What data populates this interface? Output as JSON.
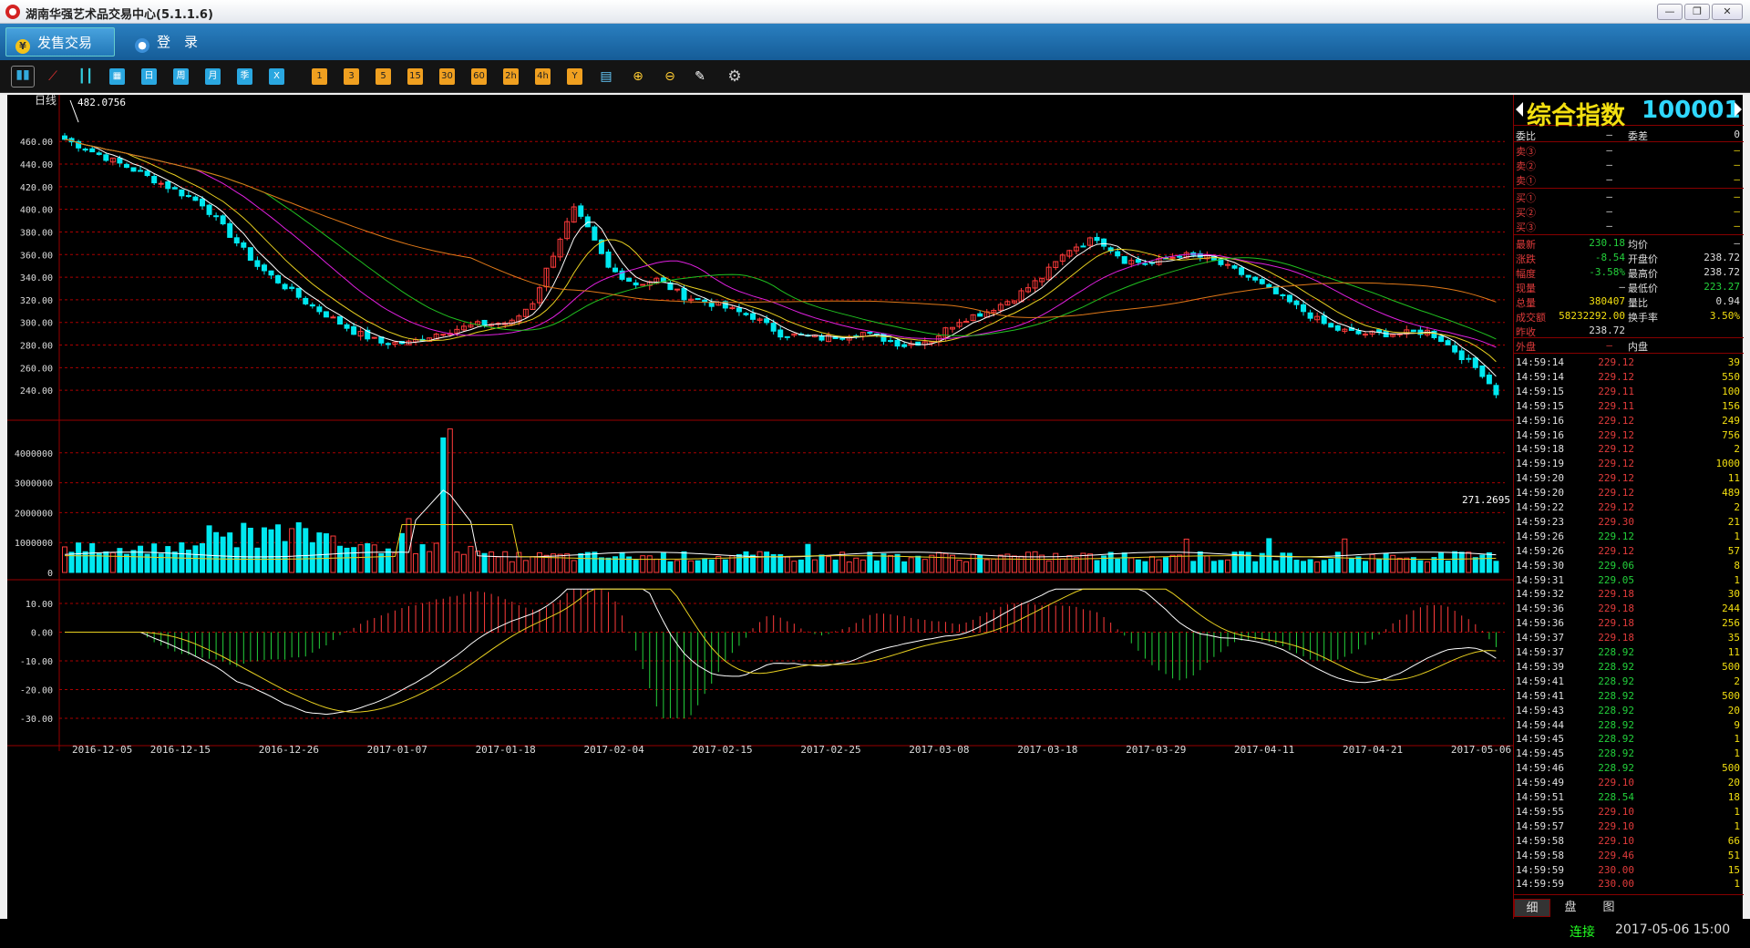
{
  "window": {
    "title": "湖南华强艺术品交易中心(5.1.1.6)",
    "min": "—",
    "max": "❐",
    "close": "✕"
  },
  "menu": {
    "trade": "发售交易",
    "login": "登　录"
  },
  "toolbar": {
    "periods": [
      "日",
      "周",
      "月",
      "季",
      "X"
    ],
    "minutes": [
      "1",
      "3",
      "5",
      "15",
      "30",
      "60",
      "2h",
      "4h",
      "Y"
    ]
  },
  "chart": {
    "period_label": "日线",
    "max_label": "482.0756",
    "min_label": "271.2695",
    "dates": [
      "2016-12-05",
      "2016-12-15",
      "2016-12-26",
      "2017-01-07",
      "2017-01-18",
      "2017-02-04",
      "2017-02-15",
      "2017-02-25",
      "2017-03-08",
      "2017-03-18",
      "2017-03-29",
      "2017-04-11",
      "2017-04-21",
      "2017-05-06"
    ]
  },
  "chart_data": [
    {
      "type": "candlestick",
      "name": "price",
      "ylim": [
        220,
        490
      ],
      "ticks": [
        240,
        260,
        280,
        300,
        320,
        340,
        360,
        380,
        400,
        420,
        440,
        460
      ],
      "tick_labels": [
        "240.00",
        "260.00",
        "280.00",
        "300.00",
        "320.00",
        "340.00",
        "360.00",
        "380.00",
        "400.00",
        "420.00",
        "440.00",
        "460.00"
      ]
    },
    {
      "type": "bar",
      "name": "volume",
      "ylim": [
        0,
        5000000
      ],
      "ticks": [
        0,
        1000000,
        2000000,
        3000000,
        4000000
      ],
      "tick_labels": [
        "0",
        "1000000",
        "2000000",
        "3000000",
        "4000000"
      ]
    },
    {
      "type": "bar",
      "name": "macd",
      "ylim": [
        -37,
        17
      ],
      "ticks": [
        10,
        0,
        -10,
        -20,
        -30
      ],
      "tick_labels": [
        "10.00",
        "0.00",
        "-10.00",
        "-20.00",
        "-30.00"
      ]
    }
  ],
  "quote": {
    "name": "综合指数",
    "code": "100001",
    "weibi_label": "委比",
    "weibi": "—",
    "weicha_label": "委差",
    "weicha": "0",
    "asks": [
      {
        "label": "卖③",
        "price": "—",
        "vol": "—"
      },
      {
        "label": "卖②",
        "price": "—",
        "vol": "—"
      },
      {
        "label": "卖①",
        "price": "—",
        "vol": "—"
      }
    ],
    "bids": [
      {
        "label": "买①",
        "price": "—",
        "vol": "—"
      },
      {
        "label": "买②",
        "price": "—",
        "vol": "—"
      },
      {
        "label": "买③",
        "price": "—",
        "vol": "—"
      }
    ],
    "latest_label": "最新",
    "latest": "230.18",
    "avg_label": "均价",
    "avg": "—",
    "chg_label": "涨跌",
    "chg": "-8.54",
    "open_label": "开盘价",
    "open": "238.72",
    "pct_label": "幅度",
    "pct": "-3.58%",
    "high_label": "最高价",
    "high": "238.72",
    "nowvol_label": "现量",
    "nowvol": "—",
    "low_label": "最低价",
    "low": "223.27",
    "totvol_label": "总量",
    "totvol": "380407",
    "ratio_label": "量比",
    "ratio": "0.94",
    "amt_label": "成交额",
    "amt": "58232292.00",
    "turn_label": "换手率",
    "turn": "3.50%",
    "prev_label": "昨收",
    "prev": "238.72",
    "outer_label": "外盘",
    "outer": "—",
    "inner_label": "内盘",
    "inner": "—"
  },
  "ticks": [
    [
      "14:59:14",
      "229.12",
      "39",
      "r"
    ],
    [
      "14:59:14",
      "229.12",
      "550",
      "r"
    ],
    [
      "14:59:15",
      "229.11",
      "100",
      "r"
    ],
    [
      "14:59:15",
      "229.11",
      "156",
      "r"
    ],
    [
      "14:59:16",
      "229.12",
      "249",
      "r"
    ],
    [
      "14:59:16",
      "229.12",
      "756",
      "r"
    ],
    [
      "14:59:18",
      "229.12",
      "2",
      "r"
    ],
    [
      "14:59:19",
      "229.12",
      "1000",
      "r"
    ],
    [
      "14:59:20",
      "229.12",
      "11",
      "r"
    ],
    [
      "14:59:20",
      "229.12",
      "489",
      "r"
    ],
    [
      "14:59:22",
      "229.12",
      "2",
      "r"
    ],
    [
      "14:59:23",
      "229.30",
      "21",
      "r"
    ],
    [
      "14:59:26",
      "229.12",
      "1",
      "g"
    ],
    [
      "14:59:26",
      "229.12",
      "57",
      "r"
    ],
    [
      "14:59:30",
      "229.06",
      "8",
      "g"
    ],
    [
      "14:59:31",
      "229.05",
      "1",
      "g"
    ],
    [
      "14:59:32",
      "229.18",
      "30",
      "r"
    ],
    [
      "14:59:36",
      "229.18",
      "244",
      "r"
    ],
    [
      "14:59:36",
      "229.18",
      "256",
      "r"
    ],
    [
      "14:59:37",
      "229.18",
      "35",
      "r"
    ],
    [
      "14:59:37",
      "228.92",
      "11",
      "g"
    ],
    [
      "14:59:39",
      "228.92",
      "500",
      "g"
    ],
    [
      "14:59:41",
      "228.92",
      "2",
      "g"
    ],
    [
      "14:59:41",
      "228.92",
      "500",
      "g"
    ],
    [
      "14:59:43",
      "228.92",
      "20",
      "g"
    ],
    [
      "14:59:44",
      "228.92",
      "9",
      "g"
    ],
    [
      "14:59:45",
      "228.92",
      "1",
      "g"
    ],
    [
      "14:59:45",
      "228.92",
      "1",
      "g"
    ],
    [
      "14:59:46",
      "228.92",
      "500",
      "g"
    ],
    [
      "14:59:49",
      "229.10",
      "20",
      "r"
    ],
    [
      "14:59:51",
      "228.54",
      "18",
      "g"
    ],
    [
      "14:59:55",
      "229.10",
      "1",
      "r"
    ],
    [
      "14:59:57",
      "229.10",
      "1",
      "r"
    ],
    [
      "14:59:58",
      "229.10",
      "66",
      "r"
    ],
    [
      "14:59:58",
      "229.46",
      "51",
      "r"
    ],
    [
      "14:59:59",
      "230.00",
      "15",
      "r"
    ],
    [
      "14:59:59",
      "230.00",
      "1",
      "r"
    ]
  ],
  "side_tabs": [
    "细",
    "盘",
    "图"
  ],
  "status": {
    "conn": "连接",
    "time": "2017-05-06 15:00"
  }
}
